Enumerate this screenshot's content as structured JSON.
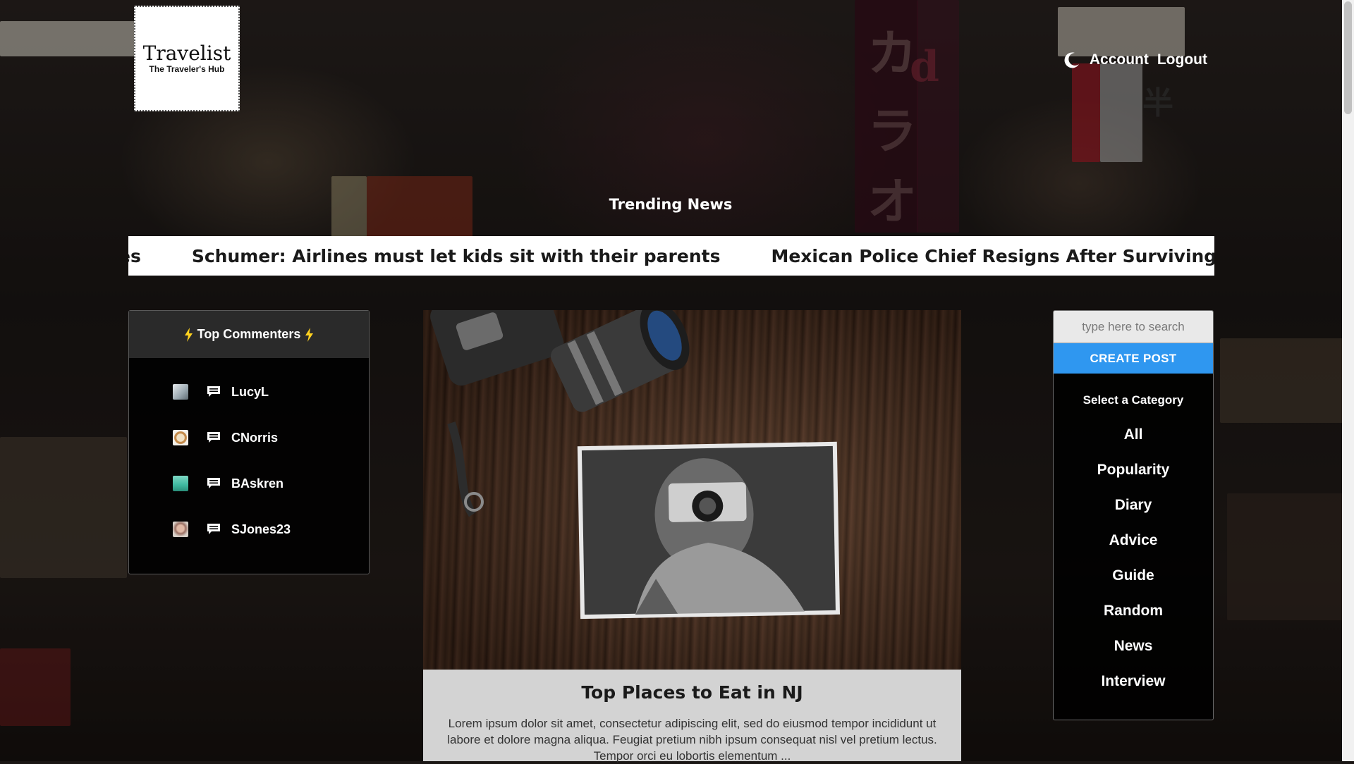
{
  "header": {
    "logo_title": "Travelist",
    "logo_subtitle": "The Traveler's Hub",
    "nav": {
      "account_label": "Account",
      "logout_label": "Logout"
    },
    "theme_toggle_icon": "moon-icon"
  },
  "trending": {
    "title": "Trending News",
    "items": [
      "es",
      "Schumer: Airlines must let kids sit with their parents",
      "Mexican Police Chief Resigns After Surviving Fierce Cartel A"
    ]
  },
  "commenters": {
    "title": "Top Commenters",
    "icon": "lightning-bolt-icon",
    "items": [
      {
        "name": "LucyL",
        "avatar_color": "#b9c3c8"
      },
      {
        "name": "CNorris",
        "avatar_color": "#c48a4a"
      },
      {
        "name": "BAskren",
        "avatar_color": "#3fb9a0"
      },
      {
        "name": "SJones23",
        "avatar_color": "#9a6f63"
      }
    ]
  },
  "post": {
    "title": "Top Places to Eat in NJ",
    "excerpt": "Lorem ipsum dolor sit amet, consectetur adipiscing elit, sed do eiusmod tempor incididunt ut labore et dolore magna aliqua. Feugiat pretium nibh ipsum consequat nisl vel pretium lectus. Tempor orci eu lobortis elementum ..."
  },
  "sidebar": {
    "search_placeholder": "type here to search",
    "create_post_label": "CREATE POST",
    "category_title": "Select a Category",
    "categories": [
      "All",
      "Popularity",
      "Diary",
      "Advice",
      "Guide",
      "Random",
      "News",
      "Interview"
    ]
  },
  "colors": {
    "accent": "#2f97f0",
    "ticker_bg": "#ffffff",
    "panel_bg": "#000000",
    "lightning": "#ffd21f"
  }
}
